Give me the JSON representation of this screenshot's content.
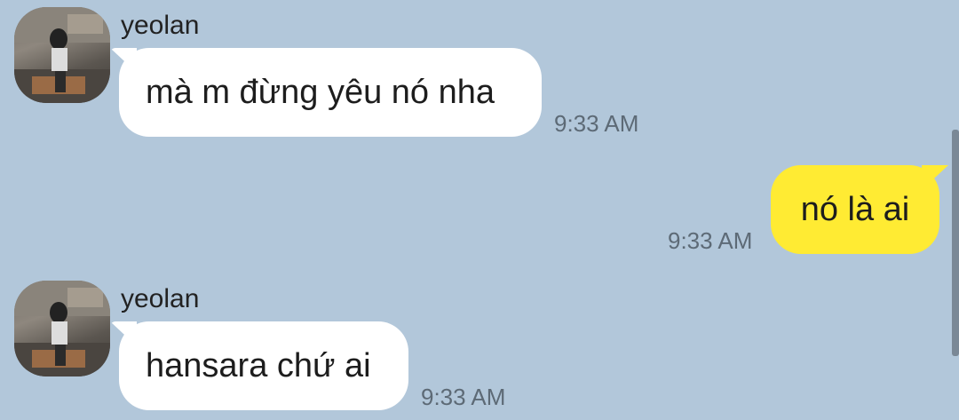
{
  "messages": [
    {
      "direction": "incoming",
      "sender": "yeolan",
      "text": "mà m đừng yêu nó nha",
      "time": "9:33 AM"
    },
    {
      "direction": "outgoing",
      "text": "nó là ai",
      "time": "9:33 AM"
    },
    {
      "direction": "incoming",
      "sender": "yeolan",
      "text": "hansara chứ ai",
      "time": "9:33 AM"
    }
  ],
  "colors": {
    "background": "#b2c7da",
    "incoming_bubble": "#ffffff",
    "outgoing_bubble": "#ffeb33",
    "timestamp": "#5d6a76"
  }
}
